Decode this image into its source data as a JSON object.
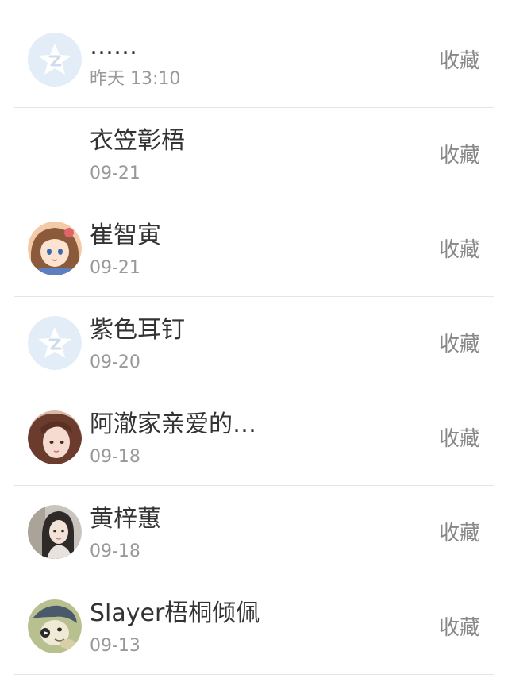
{
  "contacts": [
    {
      "name": "……",
      "time": "昨天 13:10",
      "action": "收藏",
      "avatar": "qq-default-icon"
    },
    {
      "name": "衣笠彰梧",
      "time": "09-21",
      "action": "收藏",
      "avatar": "none"
    },
    {
      "name": "崔智寅",
      "time": "09-21",
      "action": "收藏",
      "avatar": "anime-girl-photo"
    },
    {
      "name": "紫色耳钉",
      "time": "09-20",
      "action": "收藏",
      "avatar": "qq-default-icon"
    },
    {
      "name": "阿澈家亲爱的…",
      "time": "09-18",
      "action": "收藏",
      "avatar": "brown-hair-girl-photo"
    },
    {
      "name": "黄梓蕙",
      "time": "09-18",
      "action": "收藏",
      "avatar": "woman-portrait-photo"
    },
    {
      "name": "Slayer梧桐倾佩",
      "time": "09-13",
      "action": "收藏",
      "avatar": "cartoon-photo"
    }
  ],
  "colors": {
    "name_text": "#333333",
    "time_text": "#999999",
    "action_text": "#888888",
    "divider": "#e5e5e5",
    "qq_default_avatar": "#e3edf8"
  }
}
